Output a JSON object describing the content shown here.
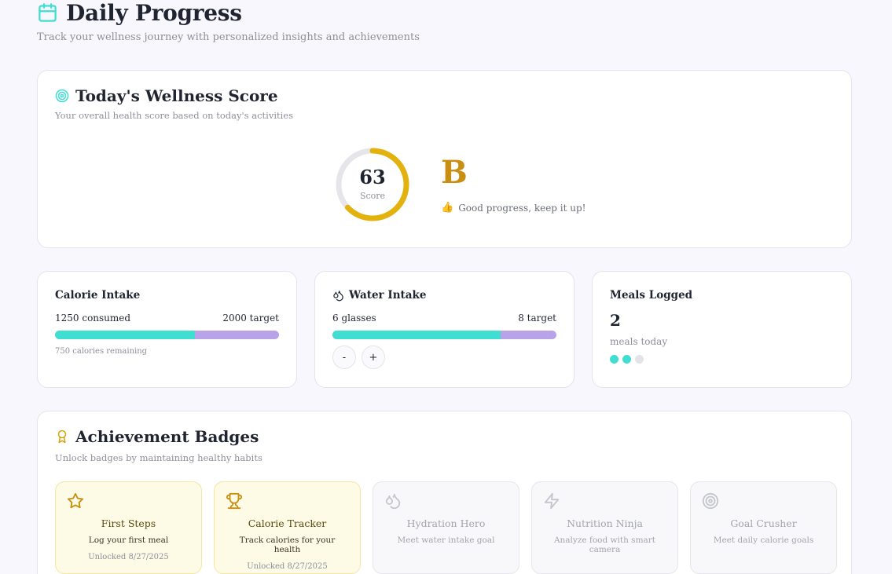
{
  "header": {
    "title": "Daily Progress",
    "subtitle": "Track your wellness journey with personalized insights and achievements"
  },
  "score": {
    "title": "Today's Wellness Score",
    "subtitle": "Your overall health score based on today's activities",
    "value": "63",
    "value_label": "Score",
    "percent": 63,
    "grade": "B",
    "message_icon": "👍",
    "message": "Good progress, keep it up!"
  },
  "calorie": {
    "title": "Calorie Intake",
    "consumed": "1250 consumed",
    "target": "2000 target",
    "progress": 0.625,
    "remaining": "750 calories remaining"
  },
  "water": {
    "title": "Water Intake",
    "glasses": "6 glasses",
    "target": "8 target",
    "progress": 0.75,
    "minus": "-",
    "plus": "+"
  },
  "meals": {
    "title": "Meals Logged",
    "count": "2",
    "label": "meals today",
    "dots_filled": 2,
    "dots_total": 3
  },
  "badges": {
    "title": "Achievement Badges",
    "subtitle": "Unlock badges by maintaining healthy habits",
    "items": [
      {
        "name": "First Steps",
        "desc": "Log your first meal",
        "date": "Unlocked 8/27/2025",
        "icon": "star-icon",
        "unlocked": true
      },
      {
        "name": "Calorie Tracker",
        "desc": "Track calories for your health",
        "date": "Unlocked 8/27/2025",
        "icon": "trophy-icon",
        "unlocked": true
      },
      {
        "name": "Hydration Hero",
        "desc": "Meet water intake goal",
        "date": "",
        "icon": "droplets-icon",
        "unlocked": false
      },
      {
        "name": "Nutrition Ninja",
        "desc": "Analyze food with smart camera",
        "date": "",
        "icon": "lightning-icon",
        "unlocked": false
      },
      {
        "name": "Goal Crusher",
        "desc": "Meet daily calorie goals",
        "date": "",
        "icon": "target-icon",
        "unlocked": false
      }
    ]
  },
  "colors": {
    "accent_teal": "#40ddd1",
    "accent_purple": "#b9a3e8",
    "gauge_gold": "#e3b20d",
    "grade_gold": "#c98f12"
  }
}
